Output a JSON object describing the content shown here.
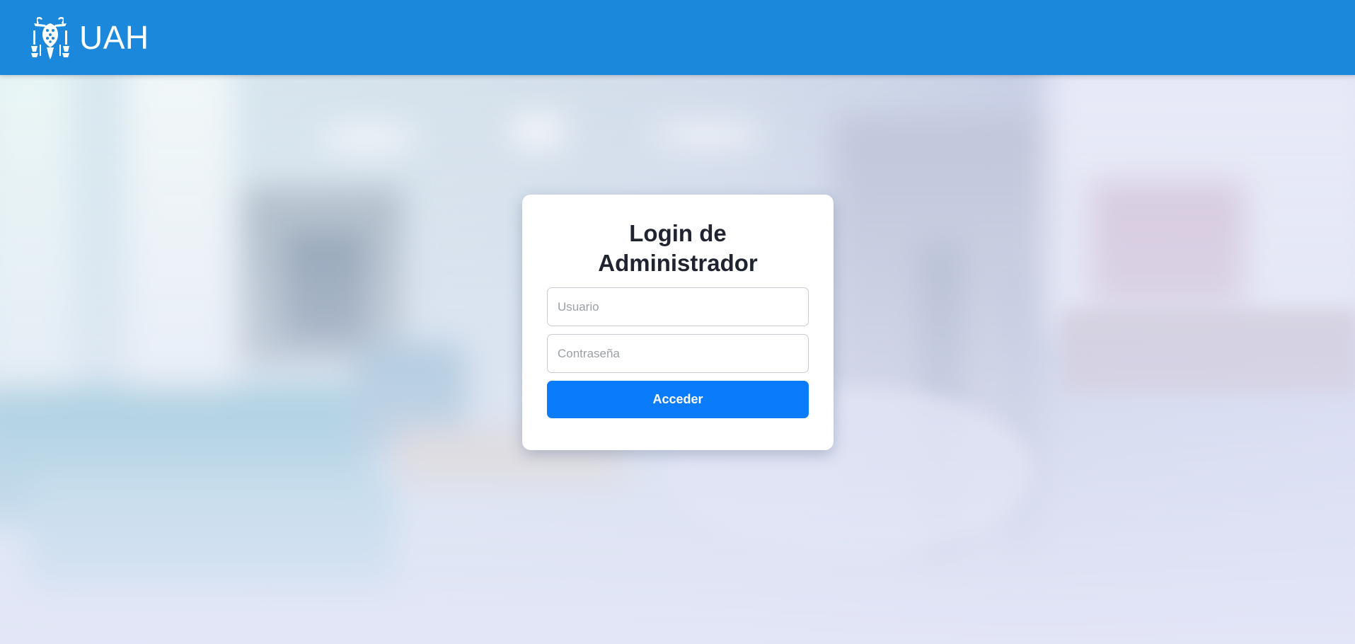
{
  "header": {
    "brand_name": "UAH",
    "logo_icon": "uah-crest-logo",
    "background_color": "#1c88dc"
  },
  "login": {
    "title": "Login de Administrador",
    "username_placeholder": "Usuario",
    "username_value": "",
    "password_placeholder": "Contraseña",
    "password_value": "",
    "submit_label": "Acceder",
    "submit_color": "#0a7bfa"
  }
}
